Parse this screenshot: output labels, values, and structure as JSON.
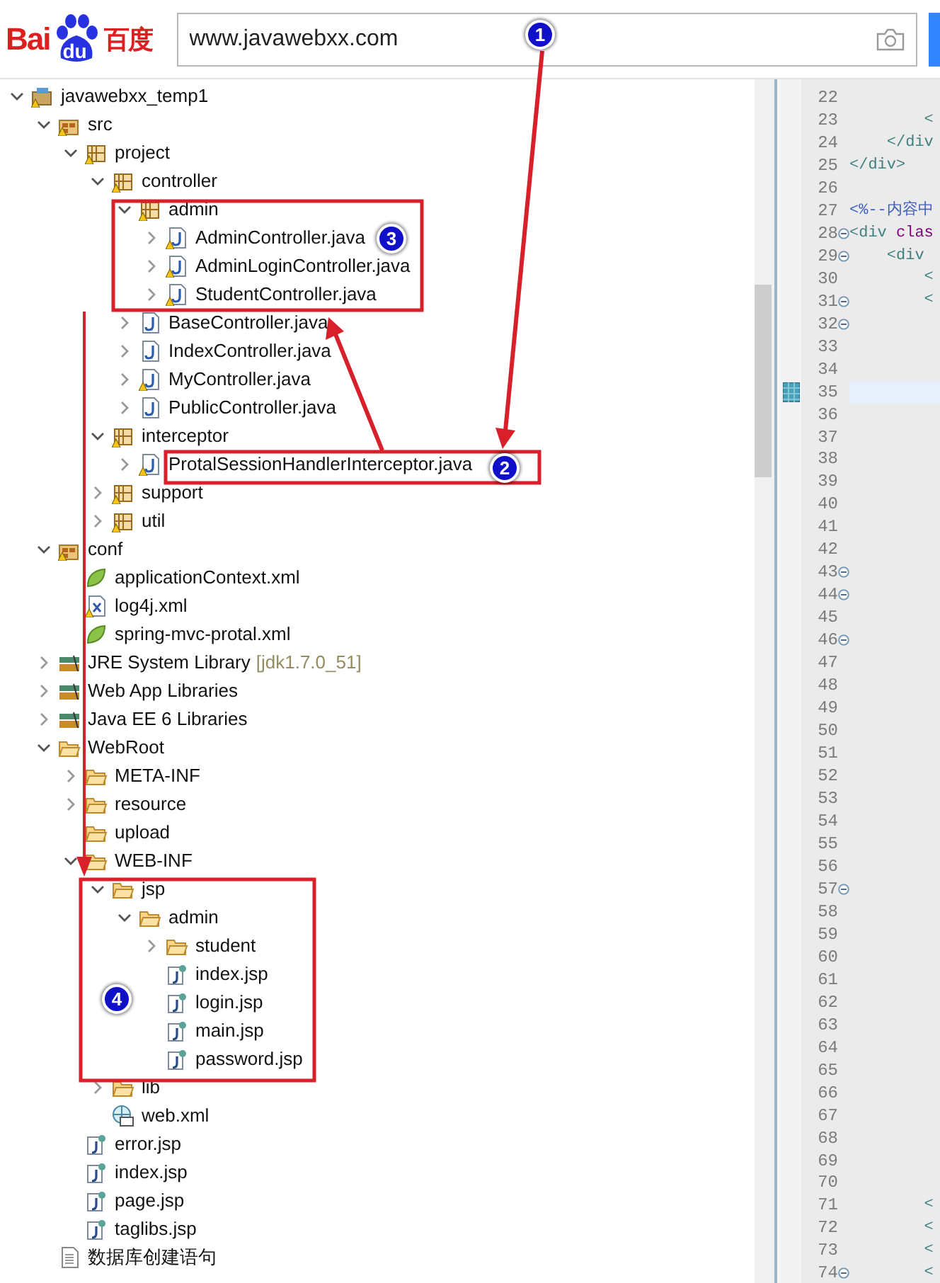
{
  "browser_bar": {
    "logo": {
      "left": "Bai",
      "paw": "du",
      "right": "百度"
    },
    "search": {
      "value": "www.javawebxx.com"
    }
  },
  "tree": [
    {
      "label": "javawebxx_temp1",
      "kind": "project",
      "warning": true,
      "expanded": true,
      "children": [
        {
          "label": "src",
          "kind": "srcfolder",
          "warning": true,
          "expanded": true,
          "children": [
            {
              "label": "project",
              "kind": "package",
              "warning": true,
              "expanded": true,
              "children": [
                {
                  "label": "controller",
                  "kind": "package",
                  "warning": true,
                  "expanded": true,
                  "children": [
                    {
                      "label": "admin",
                      "kind": "package",
                      "warning": true,
                      "expanded": true,
                      "children": [
                        {
                          "label": "AdminController.java",
                          "kind": "java",
                          "warning": true,
                          "expanded": false
                        },
                        {
                          "label": "AdminLoginController.java",
                          "kind": "java",
                          "warning": true,
                          "expanded": false
                        },
                        {
                          "label": "StudentController.java",
                          "kind": "java",
                          "warning": true,
                          "expanded": false
                        }
                      ]
                    },
                    {
                      "label": "BaseController.java",
                      "kind": "java",
                      "warning": false,
                      "expanded": false
                    },
                    {
                      "label": "IndexController.java",
                      "kind": "java",
                      "warning": false,
                      "expanded": false
                    },
                    {
                      "label": "MyController.java",
                      "kind": "java",
                      "warning": true,
                      "expanded": false
                    },
                    {
                      "label": "PublicController.java",
                      "kind": "java",
                      "warning": false,
                      "expanded": false
                    }
                  ]
                },
                {
                  "label": "interceptor",
                  "kind": "package",
                  "warning": true,
                  "expanded": true,
                  "children": [
                    {
                      "label": "ProtalSessionHandlerInterceptor.java",
                      "kind": "java",
                      "warning": true,
                      "expanded": false
                    }
                  ]
                },
                {
                  "label": "support",
                  "kind": "package",
                  "warning": true,
                  "expanded": false
                },
                {
                  "label": "util",
                  "kind": "package",
                  "warning": true,
                  "expanded": false
                }
              ]
            }
          ]
        },
        {
          "label": "conf",
          "kind": "srcfolder",
          "warning": true,
          "expanded": true,
          "children": [
            {
              "label": "applicationContext.xml",
              "kind": "spring",
              "warning": false
            },
            {
              "label": "log4j.xml",
              "kind": "xml",
              "warning": true
            },
            {
              "label": "spring-mvc-protal.xml",
              "kind": "spring",
              "warning": false
            }
          ]
        },
        {
          "label": "JRE System Library",
          "decoration": "[jdk1.7.0_51]",
          "kind": "library",
          "warning": false,
          "expanded": false
        },
        {
          "label": "Web App Libraries",
          "kind": "library",
          "warning": false,
          "expanded": false
        },
        {
          "label": "Java EE 6 Libraries",
          "kind": "library",
          "warning": false,
          "expanded": false
        },
        {
          "label": "WebRoot",
          "kind": "folder",
          "warning": false,
          "expanded": true,
          "children": [
            {
              "label": "META-INF",
              "kind": "folder",
              "warning": false,
              "expanded": false
            },
            {
              "label": "resource",
              "kind": "folder",
              "warning": false,
              "expanded": false
            },
            {
              "label": "upload",
              "kind": "folder",
              "warning": false
            },
            {
              "label": "WEB-INF",
              "kind": "folder",
              "warning": false,
              "expanded": true,
              "children": [
                {
                  "label": "jsp",
                  "kind": "folder",
                  "warning": false,
                  "expanded": true,
                  "children": [
                    {
                      "label": "admin",
                      "kind": "folder",
                      "warning": false,
                      "expanded": true,
                      "children": [
                        {
                          "label": "student",
                          "kind": "folder",
                          "warning": false,
                          "expanded": false
                        },
                        {
                          "label": "index.jsp",
                          "kind": "jsp",
                          "warning": false
                        },
                        {
                          "label": "login.jsp",
                          "kind": "jsp",
                          "warning": false
                        },
                        {
                          "label": "main.jsp",
                          "kind": "jsp",
                          "warning": false
                        },
                        {
                          "label": "password.jsp",
                          "kind": "jsp",
                          "warning": false
                        }
                      ]
                    }
                  ]
                },
                {
                  "label": "lib",
                  "kind": "folder",
                  "warning": false,
                  "expanded": false
                },
                {
                  "label": "web.xml",
                  "kind": "webxml",
                  "warning": false
                }
              ]
            },
            {
              "label": "error.jsp",
              "kind": "jsp",
              "warning": false
            },
            {
              "label": "index.jsp",
              "kind": "jsp",
              "warning": false
            },
            {
              "label": "page.jsp",
              "kind": "jsp",
              "warning": false
            },
            {
              "label": "taglibs.jsp",
              "kind": "jsp",
              "warning": false
            }
          ]
        },
        {
          "label": "数据库创建语句",
          "kind": "text",
          "warning": false
        }
      ]
    }
  ],
  "editor": {
    "lines": [
      {
        "number": "22",
        "fold": false,
        "current": false
      },
      {
        "number": "23",
        "fold": false,
        "current": false,
        "code": [
          {
            "text": "        <",
            "kind": "tag"
          }
        ]
      },
      {
        "number": "24",
        "fold": false,
        "current": false,
        "code": [
          {
            "text": "    </div",
            "kind": "tag"
          }
        ]
      },
      {
        "number": "25",
        "fold": false,
        "current": false,
        "code": [
          {
            "text": "</div>",
            "kind": "tag"
          }
        ]
      },
      {
        "number": "26",
        "fold": false,
        "current": false
      },
      {
        "number": "27",
        "fold": false,
        "current": false,
        "code": [
          {
            "text": "<%--内容中",
            "kind": "comment"
          }
        ]
      },
      {
        "number": "28",
        "fold": true,
        "current": false,
        "code": [
          {
            "text": "<div",
            "kind": "tag"
          },
          {
            "text": " clas",
            "kind": "attr"
          }
        ]
      },
      {
        "number": "29",
        "fold": true,
        "current": false,
        "code": [
          {
            "text": "    <div",
            "kind": "tag"
          }
        ]
      },
      {
        "number": "30",
        "fold": false,
        "current": false,
        "code": [
          {
            "text": "        <",
            "kind": "tag"
          }
        ]
      },
      {
        "number": "31",
        "fold": true,
        "current": false,
        "code": [
          {
            "text": "        <",
            "kind": "tag"
          }
        ]
      },
      {
        "number": "32",
        "fold": true,
        "current": false
      },
      {
        "number": "33",
        "fold": false,
        "current": false
      },
      {
        "number": "34",
        "fold": false,
        "current": false
      },
      {
        "number": "35",
        "fold": false,
        "current": true
      },
      {
        "number": "36",
        "fold": false,
        "current": false
      },
      {
        "number": "37",
        "fold": false,
        "current": false
      },
      {
        "number": "38",
        "fold": false,
        "current": false
      },
      {
        "number": "39",
        "fold": false,
        "current": false
      },
      {
        "number": "40",
        "fold": false,
        "current": false
      },
      {
        "number": "41",
        "fold": false,
        "current": false
      },
      {
        "number": "42",
        "fold": false,
        "current": false
      },
      {
        "number": "43",
        "fold": true,
        "current": false
      },
      {
        "number": "44",
        "fold": true,
        "current": false
      },
      {
        "number": "45",
        "fold": false,
        "current": false
      },
      {
        "number": "46",
        "fold": true,
        "current": false
      },
      {
        "number": "47",
        "fold": false,
        "current": false
      },
      {
        "number": "48",
        "fold": false,
        "current": false
      },
      {
        "number": "49",
        "fold": false,
        "current": false
      },
      {
        "number": "50",
        "fold": false,
        "current": false
      },
      {
        "number": "51",
        "fold": false,
        "current": false
      },
      {
        "number": "52",
        "fold": false,
        "current": false
      },
      {
        "number": "53",
        "fold": false,
        "current": false
      },
      {
        "number": "54",
        "fold": false,
        "current": false
      },
      {
        "number": "55",
        "fold": false,
        "current": false
      },
      {
        "number": "56",
        "fold": false,
        "current": false
      },
      {
        "number": "57",
        "fold": true,
        "current": false
      },
      {
        "number": "58",
        "fold": false,
        "current": false
      },
      {
        "number": "59",
        "fold": false,
        "current": false
      },
      {
        "number": "60",
        "fold": false,
        "current": false
      },
      {
        "number": "61",
        "fold": false,
        "current": false
      },
      {
        "number": "62",
        "fold": false,
        "current": false
      },
      {
        "number": "63",
        "fold": false,
        "current": false
      },
      {
        "number": "64",
        "fold": false,
        "current": false
      },
      {
        "number": "65",
        "fold": false,
        "current": false
      },
      {
        "number": "66",
        "fold": false,
        "current": false
      },
      {
        "number": "67",
        "fold": false,
        "current": false
      },
      {
        "number": "68",
        "fold": false,
        "current": false
      },
      {
        "number": "69",
        "fold": false,
        "current": false
      },
      {
        "number": "70",
        "fold": false,
        "current": false
      },
      {
        "number": "71",
        "fold": false,
        "current": false,
        "code": [
          {
            "text": "        <",
            "kind": "tag"
          }
        ]
      },
      {
        "number": "72",
        "fold": false,
        "current": false,
        "code": [
          {
            "text": "        <",
            "kind": "tag"
          }
        ]
      },
      {
        "number": "73",
        "fold": false,
        "current": false,
        "code": [
          {
            "text": "        <",
            "kind": "tag"
          }
        ]
      },
      {
        "number": "74",
        "fold": true,
        "current": false,
        "code": [
          {
            "text": "        <",
            "kind": "tag"
          }
        ]
      }
    ]
  },
  "callouts": [
    {
      "number": "1"
    },
    {
      "number": "2"
    },
    {
      "number": "3"
    },
    {
      "number": "4"
    }
  ]
}
